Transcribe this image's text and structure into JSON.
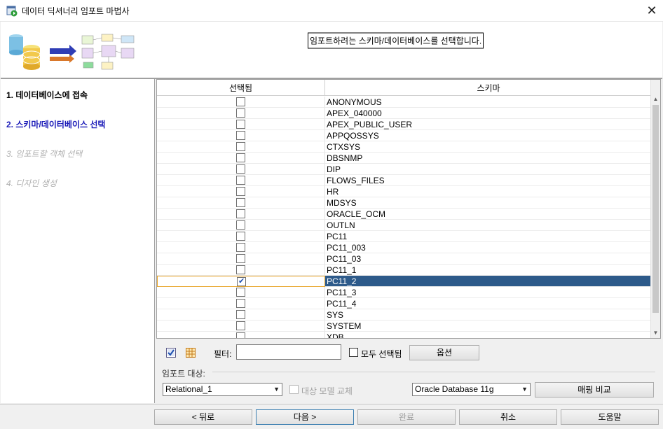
{
  "window": {
    "title": "데이터 딕셔너리 임포트 마법사"
  },
  "banner": {
    "message": "임포트하려는 스키마/데이터베이스를 선택합니다."
  },
  "steps": [
    {
      "label": "1. 데이터베이스에 접속",
      "state": "done"
    },
    {
      "label": "2. 스키마/데이터베이스 선택",
      "state": "current"
    },
    {
      "label": "3. 임포트할 객체 선택",
      "state": "todo"
    },
    {
      "label": "4. 디자인 생성",
      "state": "todo"
    }
  ],
  "grid": {
    "columns": [
      "선택됨",
      "스키마"
    ],
    "rows": [
      {
        "schema": "ANONYMOUS",
        "selected": false
      },
      {
        "schema": "APEX_040000",
        "selected": false
      },
      {
        "schema": "APEX_PUBLIC_USER",
        "selected": false
      },
      {
        "schema": "APPQOSSYS",
        "selected": false
      },
      {
        "schema": "CTXSYS",
        "selected": false
      },
      {
        "schema": "DBSNMP",
        "selected": false
      },
      {
        "schema": "DIP",
        "selected": false
      },
      {
        "schema": "FLOWS_FILES",
        "selected": false
      },
      {
        "schema": "HR",
        "selected": false
      },
      {
        "schema": "MDSYS",
        "selected": false
      },
      {
        "schema": "ORACLE_OCM",
        "selected": false
      },
      {
        "schema": "OUTLN",
        "selected": false
      },
      {
        "schema": "PC11",
        "selected": false
      },
      {
        "schema": "PC11_003",
        "selected": false
      },
      {
        "schema": "PC11_03",
        "selected": false
      },
      {
        "schema": "PC11_1",
        "selected": false
      },
      {
        "schema": "PC11_2",
        "selected": true,
        "highlighted": true
      },
      {
        "schema": "PC11_3",
        "selected": false
      },
      {
        "schema": "PC11_4",
        "selected": false
      },
      {
        "schema": "SYS",
        "selected": false
      },
      {
        "schema": "SYSTEM",
        "selected": false
      },
      {
        "schema": "XDB",
        "selected": false
      }
    ]
  },
  "toolbar": {
    "filter_label": "필터:",
    "filter_value": "",
    "select_all_label": "모두 선택됨",
    "options_label": "옵션"
  },
  "import_target": {
    "group_label": "임포트 대상:",
    "design_value": "Relational_1",
    "replace_label": "대상 모델 교체",
    "db_value": "Oracle Database 11g",
    "compare_label": "매핑 비교"
  },
  "footer": {
    "back_label": "< 뒤로",
    "next_label": "다음 >",
    "finish_label": "완료",
    "cancel_label": "취소",
    "help_label": "도움말"
  },
  "colors": {
    "current_step": "#1a1ab8",
    "selected_row": "#2d5a8a",
    "focus_border": "#e8a52a"
  }
}
